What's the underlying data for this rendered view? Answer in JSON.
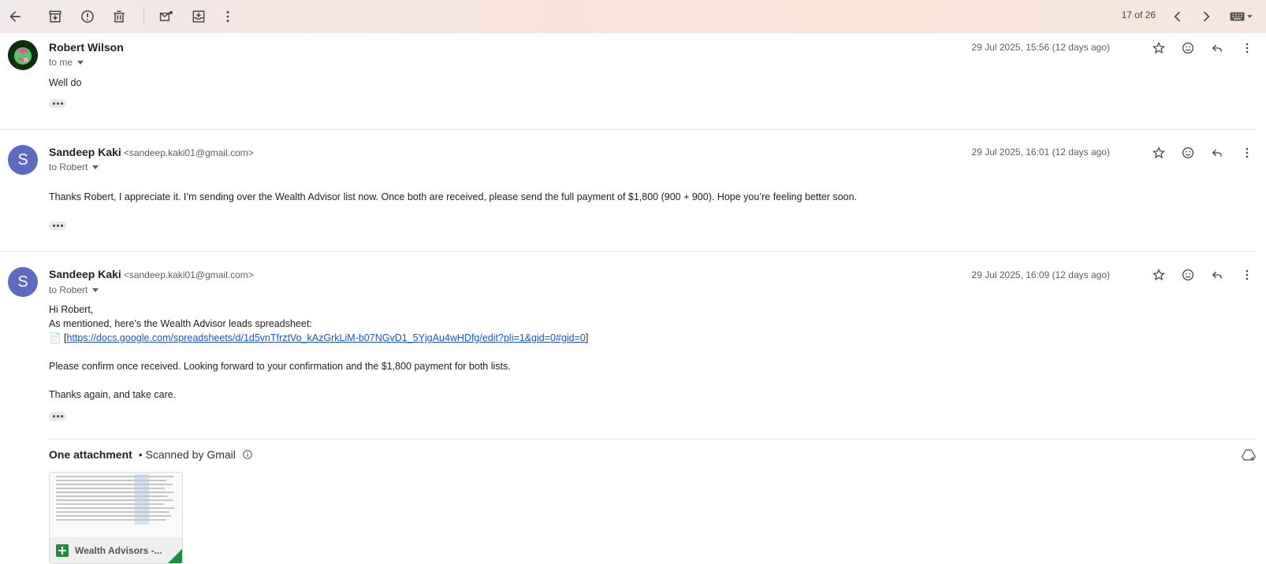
{
  "toolbar": {
    "counter": "17 of 26"
  },
  "messages": [
    {
      "sender": "Robert Wilson",
      "email": "",
      "to": "to me",
      "date": "29 Jul 2025, 15:56 (12 days ago)",
      "body": [
        "Well do"
      ]
    },
    {
      "sender": "Sandeep Kaki",
      "email": "<sandeep.kaki01@gmail.com>",
      "to": "to Robert",
      "date": "29 Jul 2025, 16:01 (12 days ago)",
      "body": [
        "Thanks Robert, I appreciate it. I’m sending over the Wealth Advisor list now. Once both are received, please send the full payment of $1,800 (900 + 900). Hope you’re feeling better soon."
      ]
    },
    {
      "sender": "Sandeep Kaki",
      "email": "<sandeep.kaki01@gmail.com>",
      "to": "to Robert",
      "date": "29 Jul 2025, 16:09 (12 days ago)",
      "body": [
        "Hi Robert,",
        "As mentioned, here’s the Wealth Advisor leads spreadsheet:",
        "Please confirm once received. Looking forward to your confirmation and the $1,800 payment for both lists.",
        "Thanks again, and take care."
      ],
      "link_prefix": "📄 [",
      "link": "https://docs.google.com/spreadsheets/d/1d5vnTfrztVo_kAzGrkLiM-b07NGvD1_5YjgAu4wHDfg/edit?pli=1&gid=0#gid=0",
      "link_suffix": "]"
    }
  ],
  "attachments": {
    "title": "One attachment",
    "scanned": "• Scanned by Gmail",
    "file_name": "Wealth Advisors -..."
  },
  "colors": {
    "avatar_s": "#5c6bc0",
    "link": "#1a56c4",
    "sheets_green": "#1e8e3e"
  }
}
